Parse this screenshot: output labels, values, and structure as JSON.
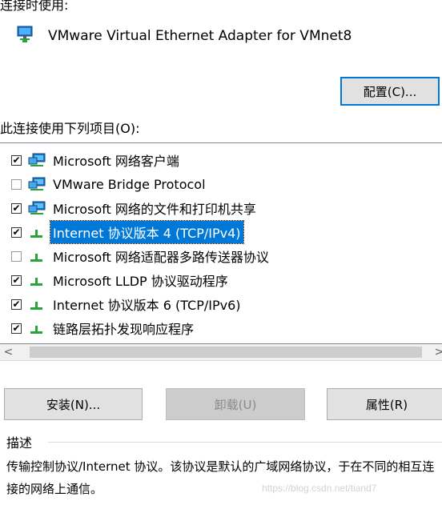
{
  "connect_using_label": "连接时使用:",
  "adapter_name": "VMware Virtual Ethernet Adapter for VMnet8",
  "configure_button": "配置(C)...",
  "items_heading": "此连接使用下列项目(O):",
  "items": [
    {
      "label": "Microsoft 网络客户端",
      "checked": true,
      "icon": "network-client-icon",
      "selected": false
    },
    {
      "label": "VMware Bridge Protocol",
      "checked": false,
      "icon": "network-client-icon",
      "selected": false
    },
    {
      "label": "Microsoft 网络的文件和打印机共享",
      "checked": true,
      "icon": "network-client-icon",
      "selected": false
    },
    {
      "label": "Internet 协议版本 4 (TCP/IPv4)",
      "checked": true,
      "icon": "protocol-icon",
      "selected": true
    },
    {
      "label": "Microsoft 网络适配器多路传送器协议",
      "checked": false,
      "icon": "protocol-icon",
      "selected": false
    },
    {
      "label": "Microsoft LLDP 协议驱动程序",
      "checked": true,
      "icon": "protocol-icon",
      "selected": false
    },
    {
      "label": "Internet 协议版本 6 (TCP/IPv6)",
      "checked": true,
      "icon": "protocol-icon",
      "selected": false
    },
    {
      "label": "链路层拓扑发现响应程序",
      "checked": true,
      "icon": "protocol-icon",
      "selected": false
    }
  ],
  "scroll_left_glyph": "<",
  "scroll_right_glyph": ">",
  "install_button": "安装(N)...",
  "uninstall_button": "卸载(U)",
  "properties_button": "属性(R)",
  "description_title": "描述",
  "description_text": "传输控制协议/Internet 协议。该协议是默认的广域网络协议，于在不同的相互连接的网络上通信。",
  "watermark": "https://blog.csdn.net/tiand7",
  "colors": {
    "selection": "#0078d7",
    "button_bg": "#e1e1e1",
    "disabled_bg": "#cccccc"
  }
}
